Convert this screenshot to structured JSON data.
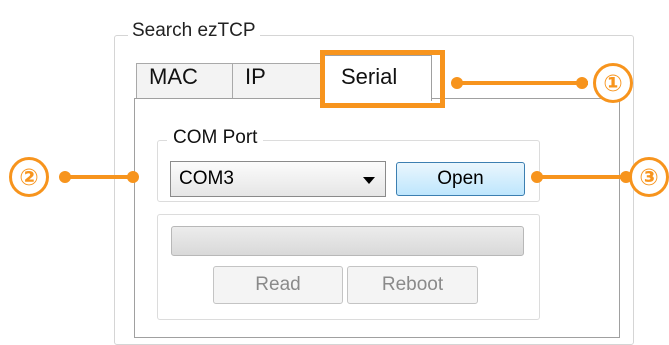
{
  "search_group": {
    "title": "Search ezTCP"
  },
  "tabs": [
    {
      "label": "MAC"
    },
    {
      "label": "IP"
    },
    {
      "label": "Serial",
      "selected": true
    }
  ],
  "com_port": {
    "title": "COM Port",
    "selected_value": "COM3",
    "open_label": "Open"
  },
  "progress": {
    "value": 0
  },
  "buttons": {
    "read_label": "Read",
    "reboot_label": "Reboot"
  },
  "callouts": [
    {
      "number": "①"
    },
    {
      "number": "②"
    },
    {
      "number": "③"
    }
  ],
  "colors": {
    "annotation": "#f7941d",
    "open_button": "#bee6fd"
  }
}
